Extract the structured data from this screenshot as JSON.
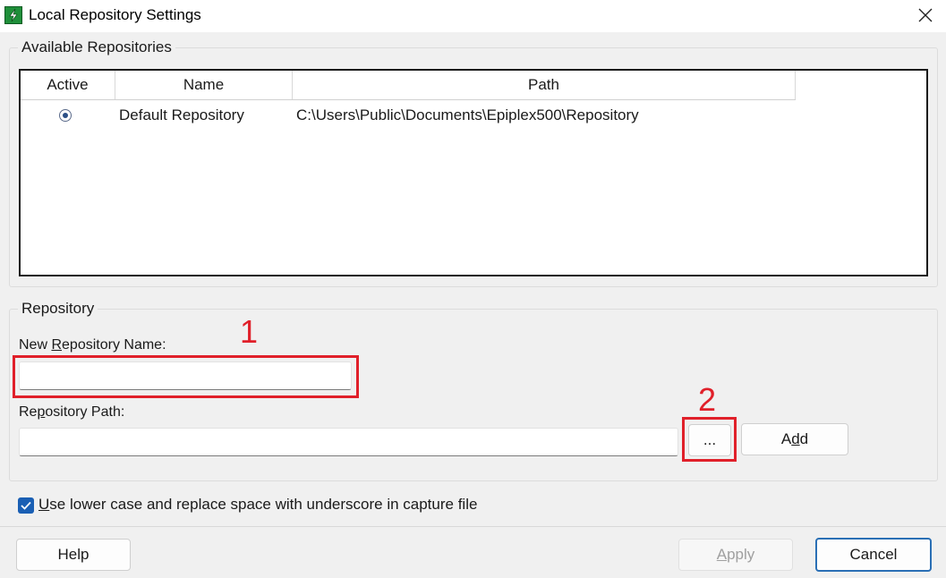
{
  "window": {
    "title": "Local Repository Settings",
    "close_label": "Close"
  },
  "available": {
    "group_label": "Available Repositories",
    "columns": [
      "Active",
      "Name",
      "Path"
    ],
    "rows": [
      {
        "active": true,
        "name": "Default Repository",
        "path": "C:\\Users\\Public\\Documents\\Epiplex500\\Repository"
      }
    ]
  },
  "repository": {
    "group_label": "Repository",
    "name_label_pre": "New ",
    "name_label_key": "R",
    "name_label_post": "epository Name:",
    "name_value": "",
    "path_label_pre": "Re",
    "path_label_key": "p",
    "path_label_post": "ository Path:",
    "path_value": "",
    "browse_label": "...",
    "add_label_pre": "A",
    "add_label_key": "d",
    "add_label_post": "d"
  },
  "options": {
    "lowercase_checked": true,
    "lowercase_label_key": "U",
    "lowercase_label_rest": "se lower case and replace space with underscore in capture file"
  },
  "footer": {
    "help_label": "Help",
    "apply_label_key": "A",
    "apply_label_rest": "pply",
    "cancel_label": "Cancel"
  },
  "annotations": {
    "first": "1",
    "second": "2"
  },
  "colors": {
    "annotation": "#e0202a",
    "accent": "#1a5fb4"
  }
}
